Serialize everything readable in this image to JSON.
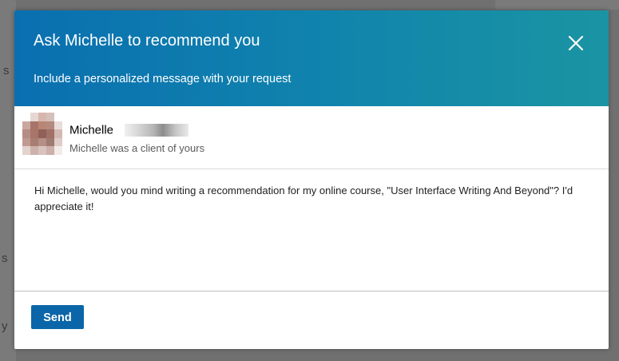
{
  "modal": {
    "title": "Ask Michelle to recommend you",
    "subtitle": "Include a personalized message with your request",
    "close_icon": "close-icon"
  },
  "recipient": {
    "first_name": "Michelle",
    "relationship": "Michelle was a client of yours",
    "avatar_icon": "avatar-photo"
  },
  "message": {
    "text": "Hi Michelle, would you mind writing a recommendation for my online course, \"User Interface Writing And Beyond\"? I'd appreciate it!"
  },
  "footer": {
    "send_label": "Send"
  },
  "colors": {
    "header_gradient_start": "#0a6fb0",
    "header_gradient_end": "#1a94a3",
    "send_button": "#0a66a8",
    "backdrop": "#707070"
  }
}
